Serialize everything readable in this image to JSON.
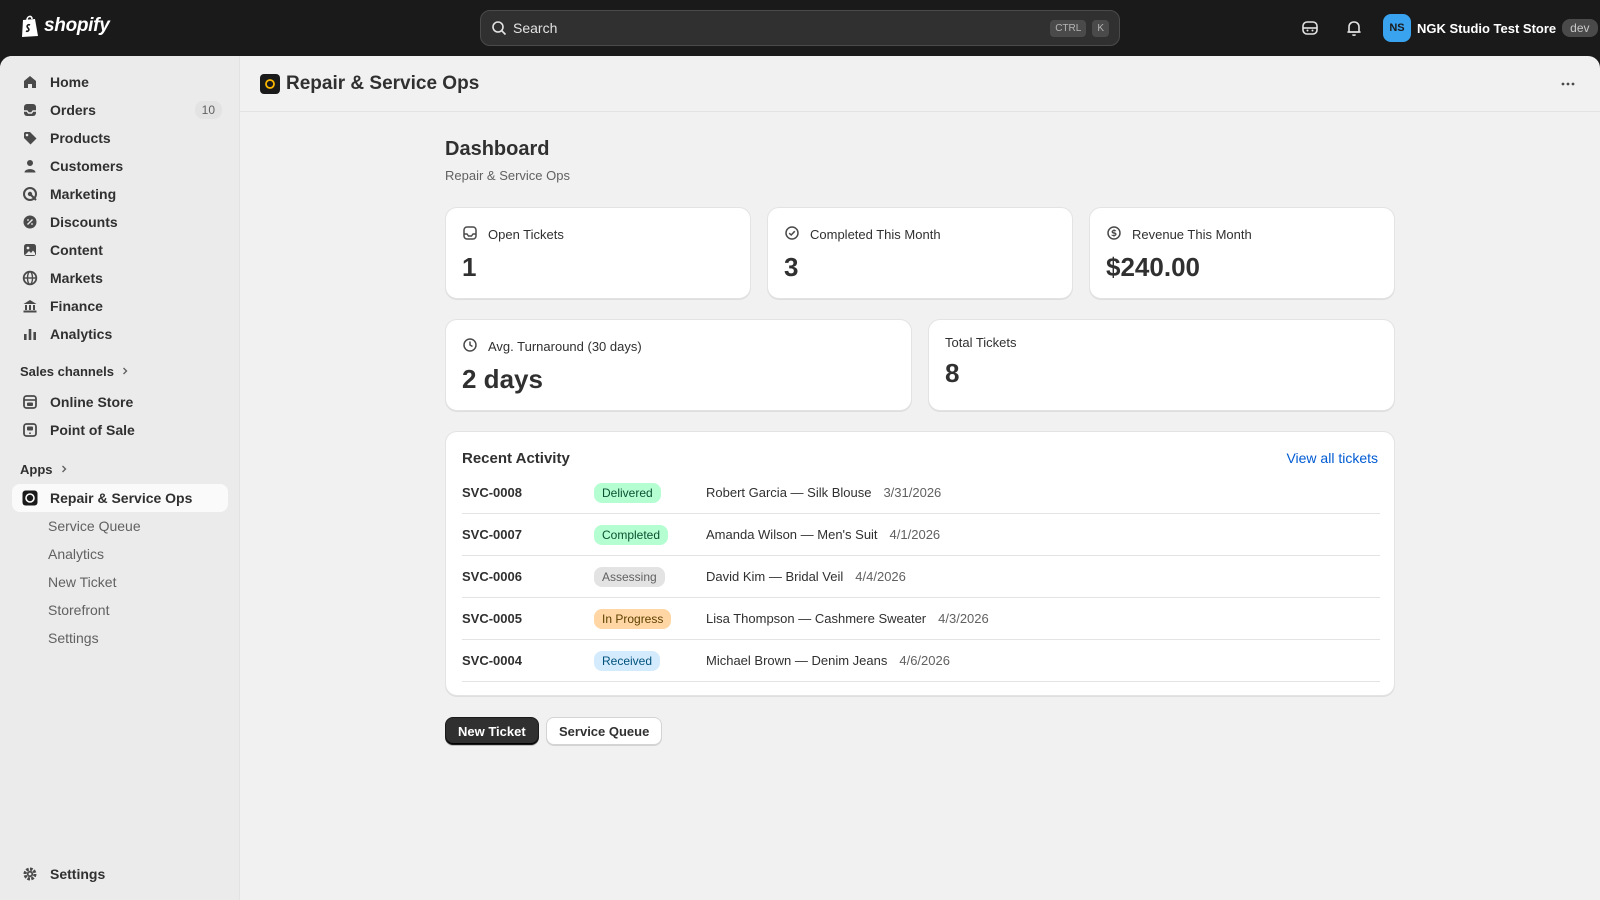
{
  "topbar": {
    "brand": "shopify",
    "search_placeholder": "Search",
    "shortcut_key1": "CTRL",
    "shortcut_key2": "K",
    "store_initials": "NS",
    "store_name": "NGK Studio Test Store",
    "env_badge": "dev"
  },
  "sidebar": {
    "items": [
      {
        "label": "Home",
        "icon": "home-icon"
      },
      {
        "label": "Orders",
        "icon": "orders-icon",
        "count": "10"
      },
      {
        "label": "Products",
        "icon": "tag-icon"
      },
      {
        "label": "Customers",
        "icon": "person-icon"
      },
      {
        "label": "Marketing",
        "icon": "target-icon"
      },
      {
        "label": "Discounts",
        "icon": "discount-icon"
      },
      {
        "label": "Content",
        "icon": "content-icon"
      },
      {
        "label": "Markets",
        "icon": "globe-icon"
      },
      {
        "label": "Finance",
        "icon": "bank-icon"
      },
      {
        "label": "Analytics",
        "icon": "bar-chart-icon"
      }
    ],
    "sales_channels_label": "Sales channels",
    "channels": [
      {
        "label": "Online Store",
        "icon": "storefront-icon"
      },
      {
        "label": "Point of Sale",
        "icon": "pos-icon"
      }
    ],
    "apps_label": "Apps",
    "app": {
      "label": "Repair & Service Ops",
      "icon": "app-logo-icon"
    },
    "app_subitems": [
      "Service Queue",
      "Analytics",
      "New Ticket",
      "Storefront",
      "Settings"
    ],
    "settings_label": "Settings"
  },
  "app_header": {
    "title": "Repair & Service Ops"
  },
  "page": {
    "title": "Dashboard",
    "subtitle": "Repair & Service Ops"
  },
  "metrics": {
    "open_tickets": {
      "label": "Open Tickets",
      "value": "1"
    },
    "completed": {
      "label": "Completed This Month",
      "value": "3"
    },
    "revenue": {
      "label": "Revenue This Month",
      "value": "$240.00"
    },
    "turnaround": {
      "label": "Avg. Turnaround (30 days)",
      "value": "2 days"
    },
    "total": {
      "label": "Total Tickets",
      "value": "8"
    }
  },
  "activity": {
    "title": "Recent Activity",
    "view_all": "View all tickets",
    "rows": [
      {
        "id": "SVC-0008",
        "status": "Delivered",
        "status_bg": "#b4fed2",
        "status_fg": "#0c5132",
        "desc": "Robert Garcia — Silk Blouse",
        "date": "3/31/2026"
      },
      {
        "id": "SVC-0007",
        "status": "Completed",
        "status_bg": "#b4fed2",
        "status_fg": "#0c5132",
        "desc": "Amanda Wilson — Men's Suit",
        "date": "4/1/2026"
      },
      {
        "id": "SVC-0006",
        "status": "Assessing",
        "status_bg": "#e3e3e3",
        "status_fg": "#616161",
        "desc": "David Kim — Bridal Veil",
        "date": "4/4/2026"
      },
      {
        "id": "SVC-0005",
        "status": "In Progress",
        "status_bg": "#ffd6a4",
        "status_fg": "#5e4200",
        "desc": "Lisa Thompson — Cashmere Sweater",
        "date": "4/3/2026"
      },
      {
        "id": "SVC-0004",
        "status": "Received",
        "status_bg": "#d4ebfd",
        "status_fg": "#00527c",
        "desc": "Michael Brown — Denim Jeans",
        "date": "4/6/2026"
      }
    ]
  },
  "actions": {
    "primary": "New Ticket",
    "secondary": "Service Queue"
  }
}
